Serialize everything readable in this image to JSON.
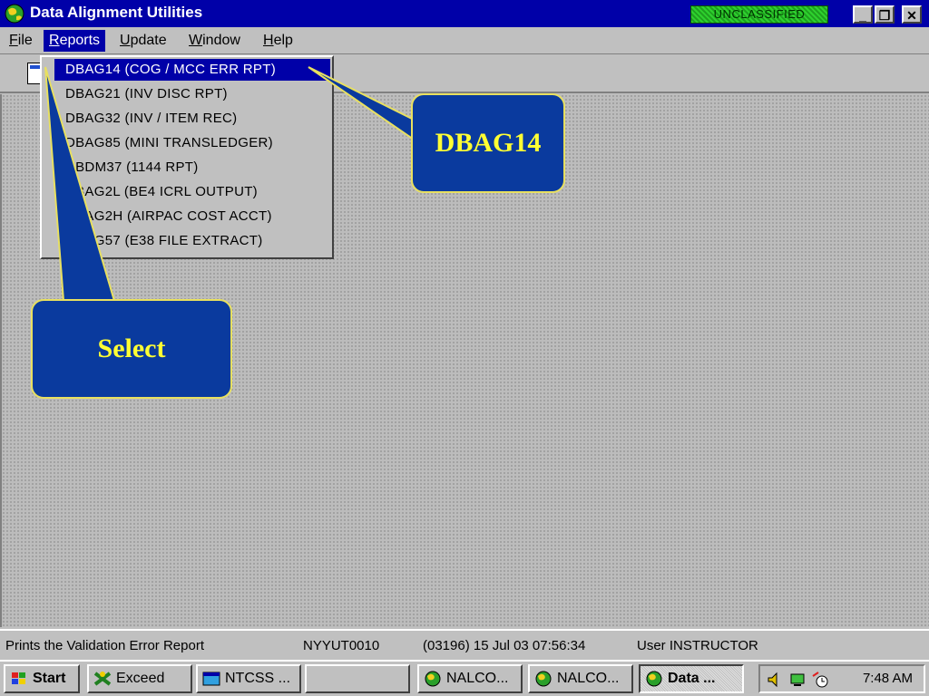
{
  "window": {
    "title": "Data Alignment Utilities",
    "classification": "UNCLASSIFIED",
    "minimize_label": "_",
    "restore_label": "❐",
    "close_label": "✕"
  },
  "menubar": {
    "items": [
      {
        "label": "File",
        "underline": "F",
        "rest": "ile"
      },
      {
        "label": "Reports",
        "underline": "R",
        "rest": "eports"
      },
      {
        "label": "Update",
        "underline": "U",
        "rest": "pdate"
      },
      {
        "label": "Window",
        "underline": "W",
        "rest": "indow"
      },
      {
        "label": "Help",
        "underline": "H",
        "rest": "elp"
      }
    ]
  },
  "reports_menu": {
    "items": [
      "DBAG14  (COG / MCC ERR RPT)",
      "DBAG21  (INV DISC RPT)",
      "DBAG32  (INV / ITEM REC)",
      "DBAG85  (MINI TRANSLEDGER)",
      "DBDM37  (1144 RPT)",
      "DBAG2L  (BE4 ICRL OUTPUT)",
      "DBAG2H  (AIRPAC COST ACCT)",
      "DBAG57 (E38 FILE EXTRACT)"
    ],
    "selected_index": 0
  },
  "callouts": {
    "report": "DBAG14",
    "action": "Select"
  },
  "statusbar": {
    "message": "Prints the Validation Error Report",
    "host": "NYYUT0010",
    "session": "(03196)  15 Jul 03  07:56:34",
    "user": "User INSTRUCTOR"
  },
  "taskbar": {
    "start": "Start",
    "buttons": [
      "Exceed",
      "NTCSS ...",
      "",
      "NALCO...",
      "NALCO...",
      "Data ..."
    ],
    "clock": "7:48 AM"
  },
  "colors": {
    "titlebar": "#0000a8",
    "callout_fill": "#0a3a9e",
    "callout_text": "#ffff33",
    "classification_badge": "#2ed12e"
  }
}
